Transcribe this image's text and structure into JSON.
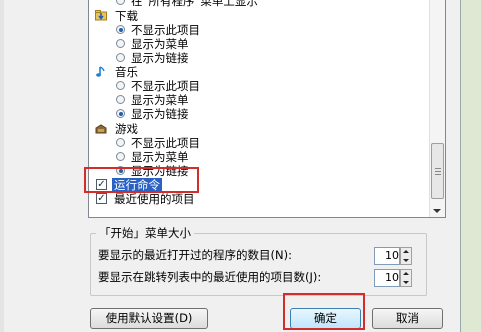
{
  "list": {
    "top_item": "在“所有程序”菜单上显示",
    "categories": [
      {
        "title": "下载",
        "icon": "download-folder-icon",
        "options": [
          "不显示此项目",
          "显示为菜单",
          "显示为链接"
        ],
        "selected": 0
      },
      {
        "title": "音乐",
        "icon": "music-note-icon",
        "options": [
          "不显示此项目",
          "显示为菜单",
          "显示为链接"
        ],
        "selected": 2
      },
      {
        "title": "游戏",
        "icon": "games-icon",
        "options": [
          "不显示此项目",
          "显示为菜单",
          "显示为链接"
        ],
        "selected": 2
      }
    ],
    "checkboxes": [
      {
        "label": "运行命令",
        "checked": true,
        "highlighted": true
      },
      {
        "label": "最近使用的项目",
        "checked": true,
        "highlighted": false
      }
    ]
  },
  "start_menu_size": {
    "title": "「开始」菜单大小",
    "recent_programs_label": "要显示的最近打开过的程序的数目(N):",
    "recent_programs_value": "10",
    "jump_list_label": "要显示在跳转列表中的最近使用的项目数(J):",
    "jump_list_value": "10"
  },
  "buttons": {
    "defaults": "使用默认设置(D)",
    "ok": "确定",
    "cancel": "取消"
  },
  "colors": {
    "highlight": "#2a61c4",
    "annotation_red": "#d42b2b"
  }
}
